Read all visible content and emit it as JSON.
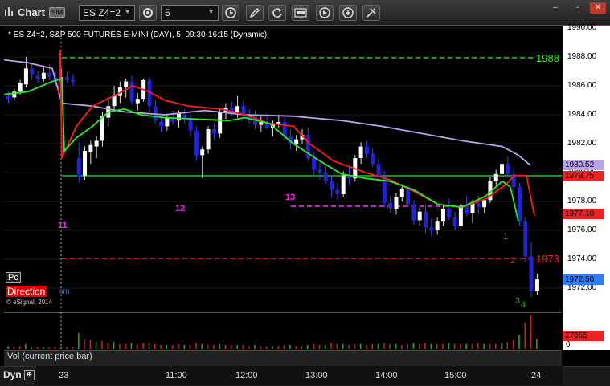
{
  "toolbar": {
    "app_title": "Chart",
    "sim_badge": "SIM",
    "symbol": "ES Z4=2",
    "interval": "5"
  },
  "chart": {
    "legend_title": "* ES Z4=2, S&P 500 FUTURES E-MINI (DAY), 5, 09:30-16:15 (Dynamic)",
    "y_ticks": [
      "1990.00",
      "1988.00",
      "1986.00",
      "1984.00",
      "1982.00",
      "1980.00",
      "1978.00",
      "1976.00",
      "1974.00",
      "1972.00"
    ],
    "price_tags": [
      {
        "text": "1980.52",
        "color": "#b9a3e8"
      },
      {
        "text": "1979.75",
        "color": "#ee2222"
      },
      {
        "text": "1977.10",
        "color": "#ee2222"
      },
      {
        "text": "1972.50",
        "color": "#2f7cff"
      }
    ],
    "level_labels": {
      "upper": "1988",
      "lower": "1973"
    },
    "annotations": {
      "a11": "11",
      "a12": "12",
      "a13": "13",
      "wave1": "1",
      "wave2": "2",
      "wave3": "3",
      "wave4": "4"
    },
    "pc_label": "Pc",
    "direction_label": "Direction",
    "direction_suffix": "om",
    "copyright": "© eSignal, 2014",
    "colors": {
      "up_bar": "#ffffff",
      "down_bar": "#2222dd",
      "red_ma": "#ff1a1a",
      "green_ma": "#22ee22",
      "purple_ma": "#b9a3e8"
    }
  },
  "volume": {
    "label": "Vol (current price bar)",
    "value_tag": "27055",
    "zero_label": "0"
  },
  "bottom": {
    "dyn_label": "Dyn",
    "time_labels": [
      "23",
      "11:00",
      "12:00",
      "13:00",
      "14:00",
      "15:00",
      "24"
    ]
  }
}
